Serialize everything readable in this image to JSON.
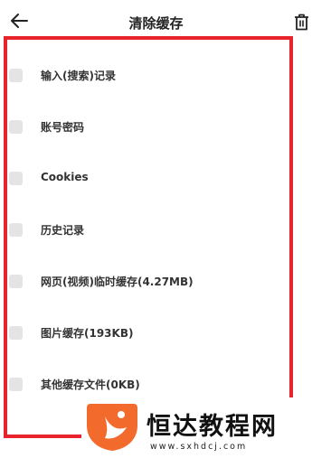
{
  "header": {
    "title": "清除缓存",
    "back_icon": "arrow-left-icon",
    "trash_icon": "trash-icon"
  },
  "cache_items": [
    {
      "label": "输入(搜索)记录",
      "checked": false
    },
    {
      "label": "账号密码",
      "checked": false
    },
    {
      "label": "Cookies",
      "checked": false
    },
    {
      "label": "历史记录",
      "checked": false
    },
    {
      "label": "网页(视频)临时缓存(4.27MB)",
      "checked": false
    },
    {
      "label": "图片缓存(193KB)",
      "checked": false
    },
    {
      "label": "其他缓存文件(0KB)",
      "checked": false
    }
  ],
  "watermark": {
    "brand": "恒达教程网",
    "url": "www.sxhdcj.com",
    "logo_color": "#f26a2c"
  },
  "colors": {
    "highlight_frame": "#e8232b",
    "checkbox": "#e4e4e4"
  }
}
